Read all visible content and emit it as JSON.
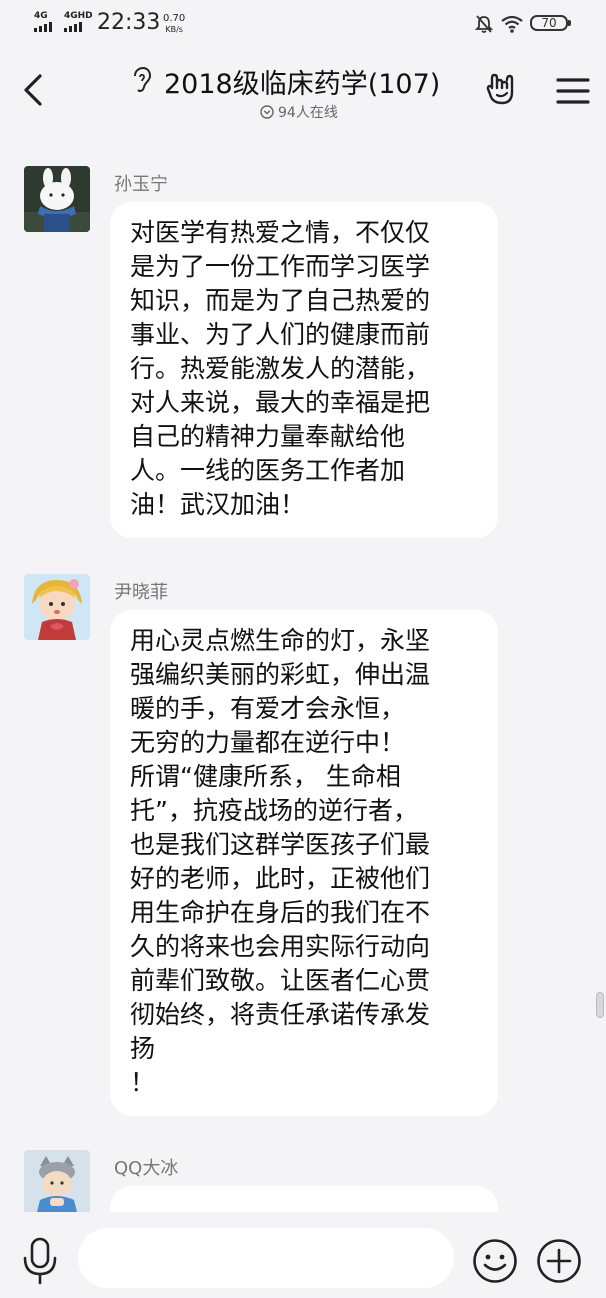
{
  "status_bar": {
    "signal1": "4G",
    "signal2": "4GHD",
    "time": "22:33",
    "speed_value": "0.70",
    "speed_unit": "KB/s",
    "battery": "70",
    "icons": [
      "mute-bell-icon",
      "wifi-icon",
      "battery-icon"
    ]
  },
  "header": {
    "title": "2018级临床药学(107)",
    "online": "94人在线",
    "icons": [
      "back-icon",
      "ear-icon",
      "hand-gesture-icon",
      "menu-icon"
    ]
  },
  "messages": [
    {
      "sender": "孙玉宁",
      "avatar": "cartoon-bunny-avatar",
      "text": "对医学有热爱之情，不仅仅\n是为了一份工作而学习医学\n知识，而是为了自己热爱的\n事业、为了人们的健康而前\n行。热爱能激发人的潜能，\n对人来说，最大的幸福是把\n自己的精神力量奉献给他\n人。一线的医务工作者加\n油！武汉加油！"
    },
    {
      "sender": "尹晓菲",
      "avatar": "cartoon-girl-avatar",
      "text": "用心灵点燃生命的灯，永坚\n强编织美丽的彩虹，伸出温\n暖的手，有爱才会永恒，\n无穷的力量都在逆行中！\n所谓“健康所系， 生命相\n托”，抗疫战场的逆行者，\n也是我们这群学医孩子们最\n好的老师，此时，正被他们\n用生命护在身后的我们在不\n久的将来也会用实际行动向\n前辈们致敬。让医者仁心贯\n彻始终，将责任承诺传承发\n扬\n！"
    },
    {
      "sender": "QQ大冰",
      "avatar": "cartoon-boy-avatar",
      "text": ""
    }
  ],
  "input_bar": {
    "icons": [
      "microphone-icon",
      "emoji-icon",
      "plus-icon"
    ]
  }
}
